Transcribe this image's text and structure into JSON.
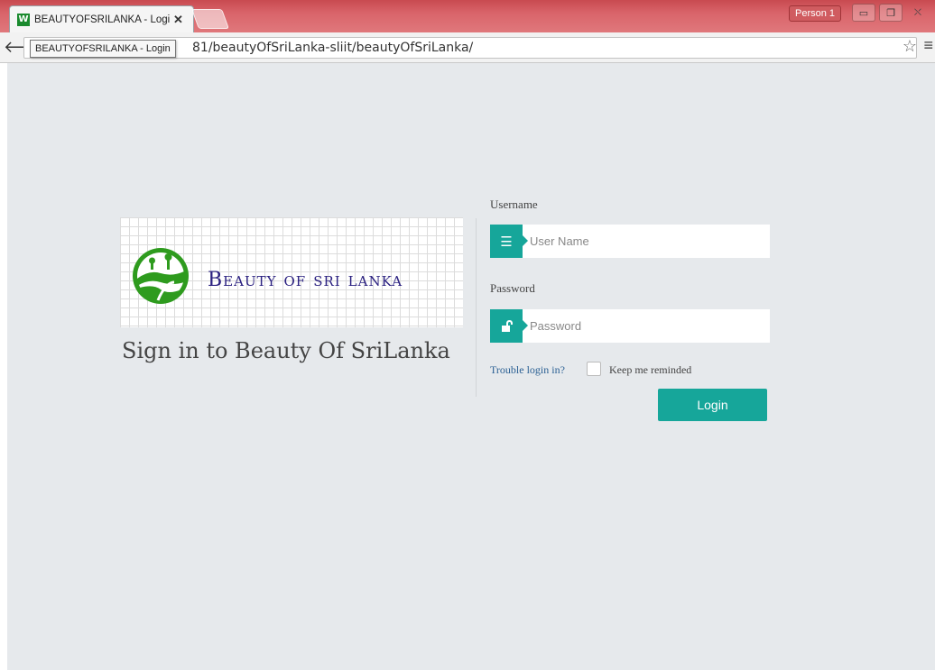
{
  "browser": {
    "tab_title": "BEAUTYOFSRILANKA - Login",
    "tab_favicon": "W",
    "tab_close": "✕",
    "profile": "Person 1",
    "tooltip": "BEAUTYOFSRILANKA - Login",
    "url_visible": "81/beautyOfSriLanka-sliit/beautyOfSriLanka/",
    "back_icon": "back-arrow-icon",
    "star_icon": "star-icon",
    "menu_icon": "hamburger-menu-icon"
  },
  "page": {
    "logo_text": "Beauty of sri lanka",
    "title": "Sign in to Beauty Of SriLanka"
  },
  "form": {
    "username_label": "Username",
    "username_placeholder": "User Name",
    "username_icon": "list-icon",
    "password_label": "Password",
    "password_placeholder": "Password",
    "password_icon": "unlock-icon",
    "trouble_link": "Trouble login in?",
    "remember_label": "Keep me reminded",
    "login_button": "Login"
  },
  "colors": {
    "accent": "#16a69a",
    "page_background": "#e6e9ec",
    "link": "#2b6094",
    "logo_text": "#2a2080",
    "logo_green": "#2e9b1e"
  }
}
